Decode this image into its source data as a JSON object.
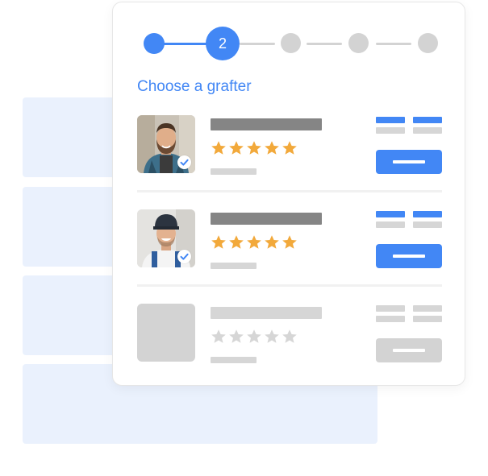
{
  "stepper": {
    "current_step": "2",
    "total_steps": 5,
    "active_color": "#4287f5",
    "inactive_color": "#d3d3d3"
  },
  "section": {
    "title": "Choose a grafter"
  },
  "grafters": [
    {
      "state": "active",
      "rating": 5,
      "verified": true,
      "avatar_icon": "bearded-man-plaid-shirt-icon"
    },
    {
      "state": "active",
      "rating": 5,
      "verified": true,
      "avatar_icon": "man-cap-overalls-icon"
    },
    {
      "state": "placeholder",
      "rating": 0,
      "verified": false,
      "avatar_icon": "empty-avatar-placeholder"
    }
  ],
  "colors": {
    "accent": "#4287f5",
    "star_filled": "#f2a93b",
    "star_empty": "#d6d6d6",
    "name_bar": "#858585",
    "muted_bar": "#d6d6d6",
    "background_block": "#eaf1fd"
  }
}
